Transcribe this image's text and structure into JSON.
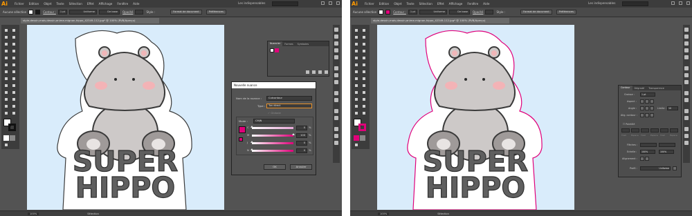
{
  "app": {
    "logo": "Ai",
    "workspace": "Les indispensables"
  },
  "menu": [
    "Fichier",
    "Edition",
    "Objet",
    "Texte",
    "Sélection",
    "Effet",
    "Affichage",
    "Fenêtre",
    "Aide"
  ],
  "control": {
    "selection_label": "Aucune sélection",
    "stroke_label": "Contour :",
    "stroke_weight": "1 pt",
    "line_style": "Uniforme",
    "brush": "De base",
    "opacity_label": "Opacité",
    "style_label": "Style :",
    "doc_format_button": "Format de document",
    "prefs_button": "Préférences"
  },
  "document": {
    "tab_title": "style-dessin-mais-dessin-anime-mignon-hippo_42349-112.jpg* @ 100% (RVB/Aperçu)",
    "zoom": "100%",
    "current_tool": "Sélection"
  },
  "artwork": {
    "line1": "SUPER",
    "line2": "HIPPO"
  },
  "swatches_panel": {
    "tabs": [
      "Nuancier",
      "Formes",
      "Symboles"
    ]
  },
  "new_swatch_dialog": {
    "title": "Nouvelle nuance",
    "name_label": "Nom de la nuance :",
    "name_value": "Cutcontour",
    "type_label": "Type :",
    "type_value": "Ton direct",
    "global_label": "Globale",
    "mode_label": "Mode :",
    "mode_value": "CMJN",
    "channels": [
      {
        "label": "C",
        "value": "0",
        "unit": "%",
        "fraction": 0.0,
        "color": "#e9a8d9"
      },
      {
        "label": "M",
        "value": "100",
        "unit": "%",
        "fraction": 1.0,
        "color": "#e0007a"
      },
      {
        "label": "J",
        "value": "0",
        "unit": "%",
        "fraction": 0.0,
        "color": "#e0007a"
      },
      {
        "label": "N",
        "value": "0",
        "unit": "%",
        "fraction": 0.0,
        "color": "#e0007a"
      }
    ],
    "ok_button": "OK",
    "cancel_button": "Annuler"
  },
  "stroke_panel": {
    "tabs": [
      "Contour",
      "Dégradé",
      "Transparence"
    ],
    "weight_label": "Graisse :",
    "weight_value": "1 pt",
    "cap_label": "Aspect :",
    "corner_label": "Angle :",
    "limit_label": "Limite :",
    "limit_value": "10",
    "align_label": "Alig. contour :",
    "dashed_label": "Pointillé",
    "dash_labels": [
      "Tiret",
      "Espace",
      "Tiret",
      "Espace",
      "Tiret",
      "Espace"
    ],
    "arrowheads_label": "Flèches :",
    "scale_label": "Echelle :",
    "scale_values": [
      "100%",
      "100%"
    ],
    "align_arrows_label": "Alignement :",
    "profile_label": "Profil :",
    "profile_value": "Uniforme"
  },
  "colors": {
    "menubar": "#3c3c3c",
    "workspace_bg": "#535353",
    "artboard": "#d9ecfb",
    "cutcontour": "#e0007a",
    "hippo_body": "#cdc9c8",
    "hippo_shade": "#9f9a99",
    "ear_inner": "#f0b6b8",
    "cheek": "#f3b3b6",
    "outline": "#3a3a3a",
    "text_fill": "#5f5f5f",
    "halo": "#ffffff"
  }
}
